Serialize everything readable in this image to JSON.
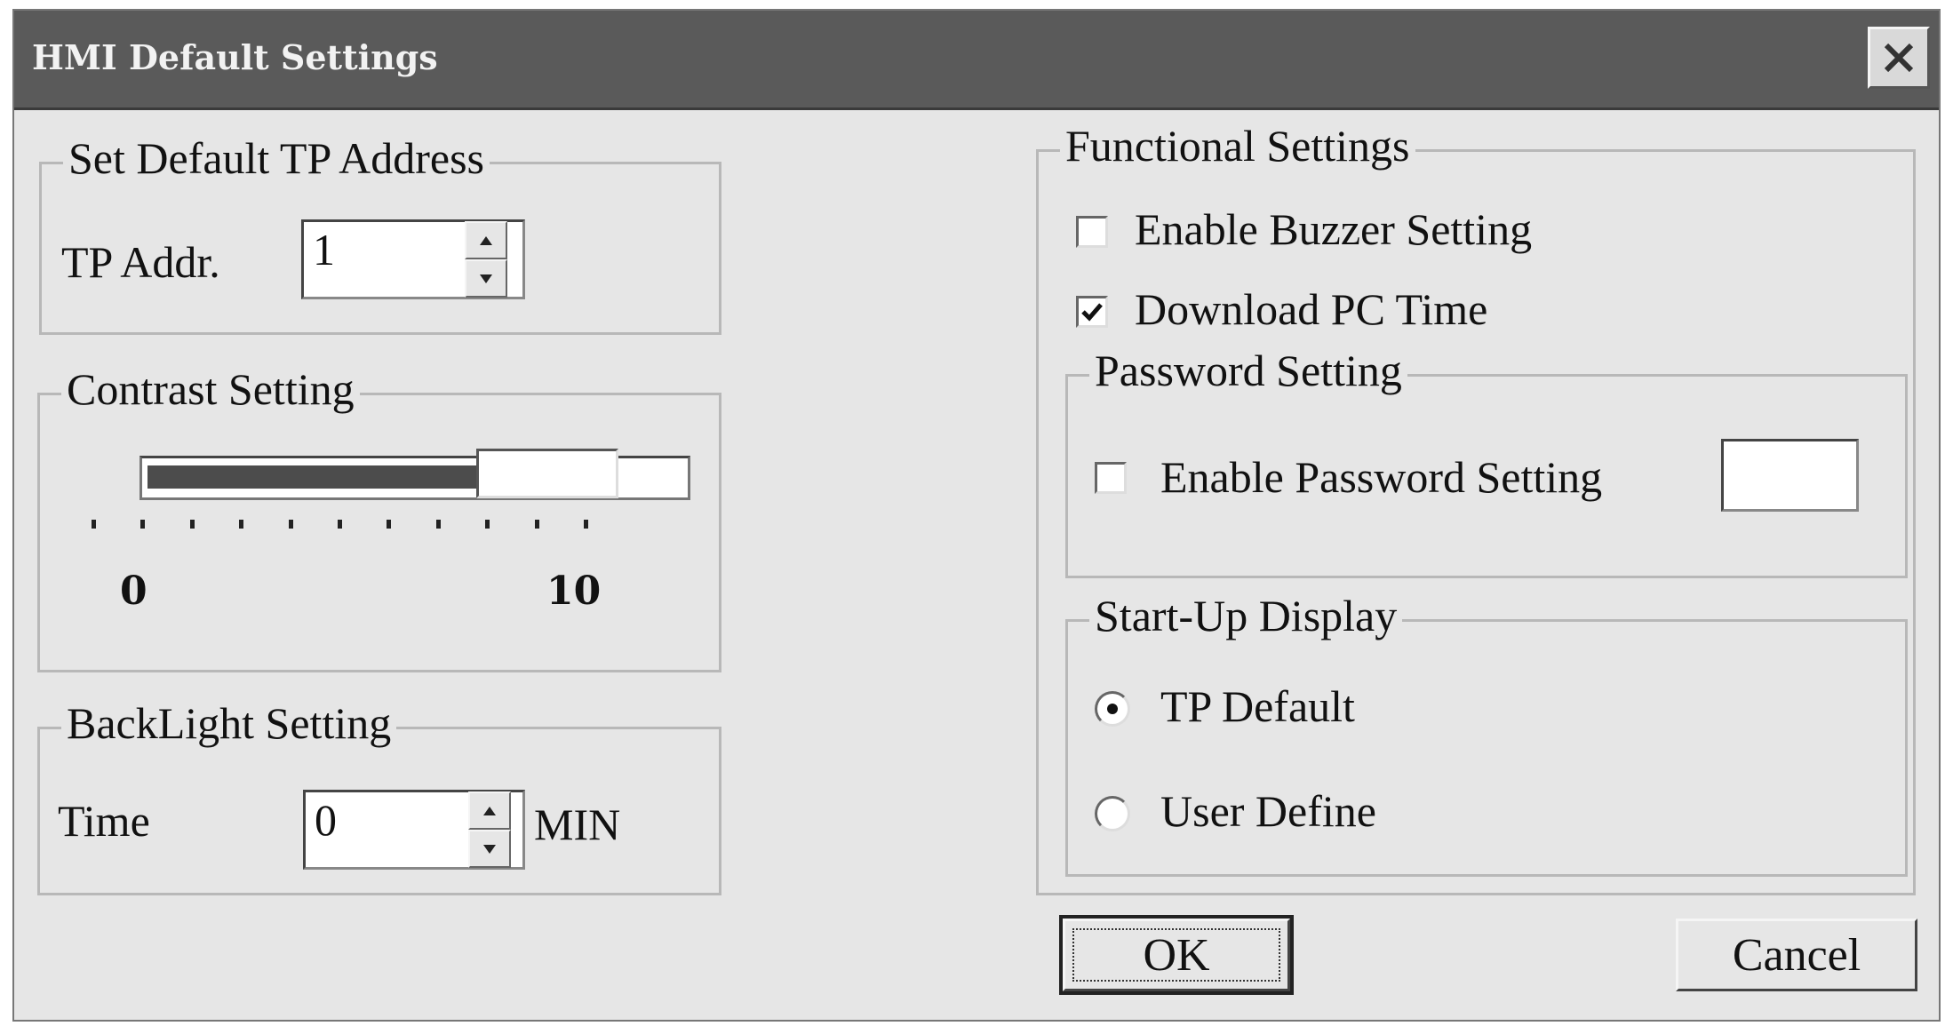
{
  "window": {
    "title": "HMI Default Settings",
    "close_icon": "close-icon"
  },
  "tp_address": {
    "legend": "Set Default TP Address",
    "label": "TP Addr.",
    "value": "1"
  },
  "contrast": {
    "legend": "Contrast Setting",
    "min_label": "0",
    "max_label": "10",
    "min": 0,
    "max": 10,
    "value": 8
  },
  "backlight": {
    "legend": "BackLight Setting",
    "label": "Time",
    "value": "0",
    "unit": "MIN"
  },
  "functional": {
    "legend": "Functional Settings",
    "buzzer": {
      "label": "Enable Buzzer Setting",
      "checked": false
    },
    "pc_time": {
      "label": "Download PC Time",
      "checked": true
    }
  },
  "password": {
    "legend": "Password Setting",
    "label": "Enable Password Setting",
    "checked": false,
    "value": ""
  },
  "startup": {
    "legend": "Start-Up Display",
    "options": [
      {
        "label": "TP Default",
        "selected": true
      },
      {
        "label": "User Define",
        "selected": false
      }
    ]
  },
  "buttons": {
    "ok": "OK",
    "cancel": "Cancel"
  }
}
